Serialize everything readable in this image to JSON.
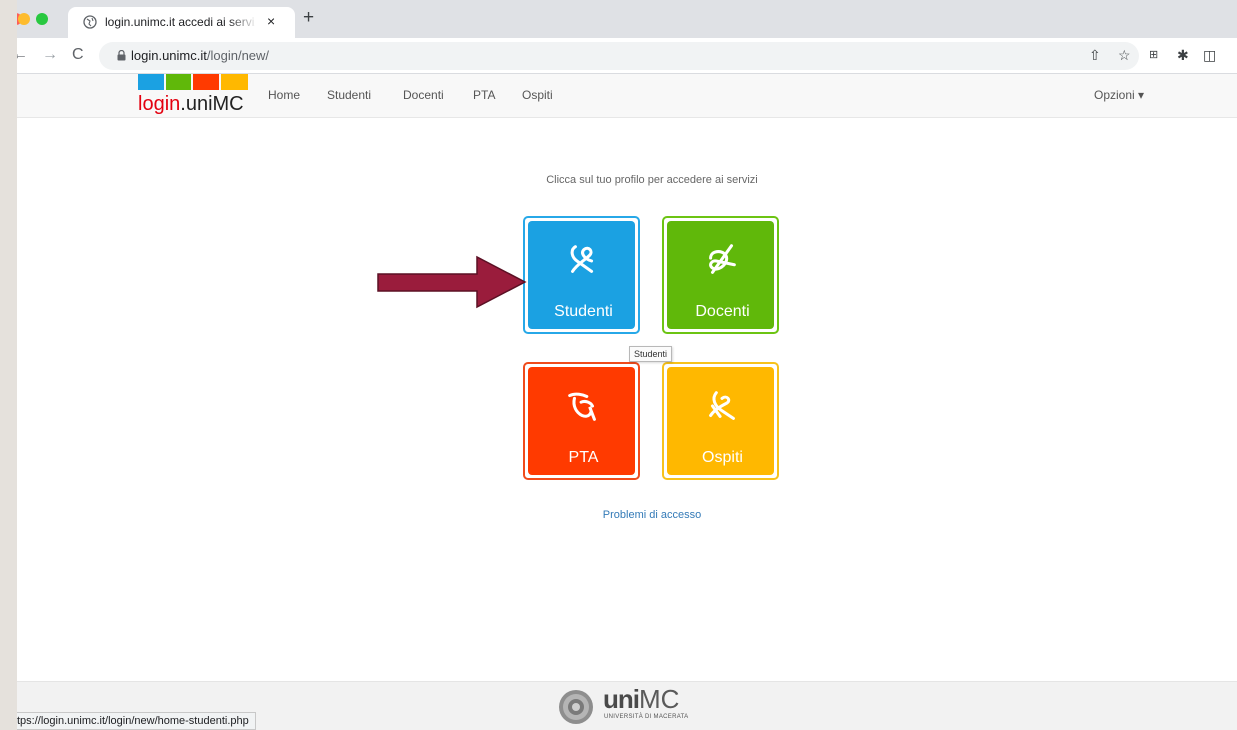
{
  "browser": {
    "tab_title": "login.unimc.it accedi ai servizi",
    "tab_close": "×",
    "new_tab": "+",
    "url_host": "login.unimc.it",
    "url_path": "/login/new/",
    "status_url": "tps://login.unimc.it/login/new/home-studenti.php"
  },
  "navbar": {
    "logo": {
      "login": "login",
      "dot": ".",
      "uni": "uniMC",
      "colors": [
        "#1ba1e2",
        "#60b80a",
        "#ff3a00",
        "#ffb800"
      ]
    },
    "links": [
      "Home",
      "Studenti",
      "Docenti",
      "PTA",
      "Ospiti"
    ],
    "options": "Opzioni ▾"
  },
  "main": {
    "subtitle": "Clicca sul tuo profilo per accedere ai servizi",
    "tiles": [
      {
        "label": "Studenti",
        "color": "#1ba1e2"
      },
      {
        "label": "Docenti",
        "color": "#60b80a"
      },
      {
        "label": "PTA",
        "color": "#ff3a00"
      },
      {
        "label": "Ospiti",
        "color": "#ffb800"
      }
    ],
    "tooltip": "Studenti",
    "access_link": "Problemi di accesso",
    "arrow_color": "#9a1c3c"
  },
  "footer": {
    "brand_bold": "uni",
    "brand_rest": "MC",
    "subtitle": "UNIVERSITÀ DI MACERATA"
  }
}
